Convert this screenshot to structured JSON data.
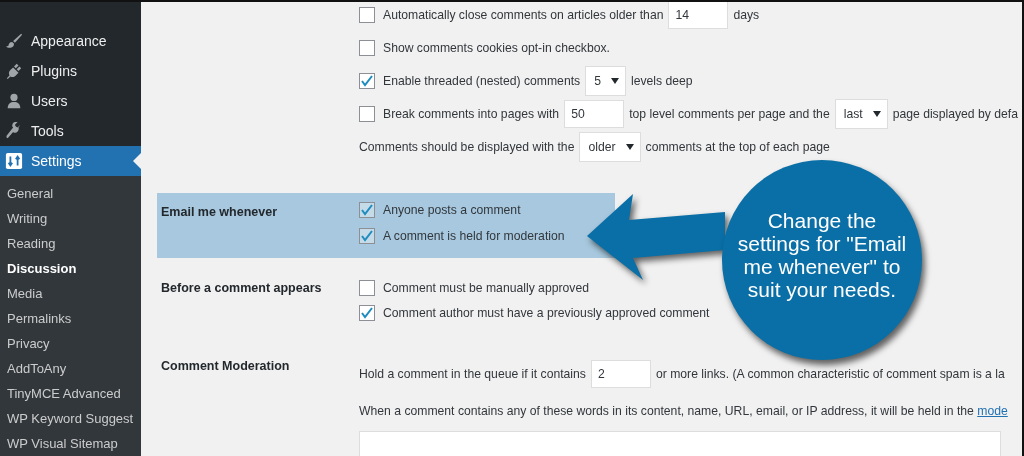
{
  "sidebar": {
    "menu": [
      {
        "label": "Appearance",
        "kind": "brush",
        "selected": false
      },
      {
        "label": "Plugins",
        "kind": "plug",
        "selected": false
      },
      {
        "label": "Users",
        "kind": "user",
        "selected": false
      },
      {
        "label": "Tools",
        "kind": "wrench",
        "selected": false
      },
      {
        "label": "Settings",
        "kind": "settings",
        "selected": true
      }
    ],
    "submenu": [
      {
        "label": "General",
        "selected": false
      },
      {
        "label": "Writing",
        "selected": false
      },
      {
        "label": "Reading",
        "selected": false
      },
      {
        "label": "Discussion",
        "selected": true
      },
      {
        "label": "Media",
        "selected": false
      },
      {
        "label": "Permalinks",
        "selected": false
      },
      {
        "label": "Privacy",
        "selected": false
      },
      {
        "label": "AddToAny",
        "selected": false
      },
      {
        "label": "TinyMCE Advanced",
        "selected": false
      },
      {
        "label": "WP Keyword Suggest",
        "selected": false
      },
      {
        "label": "WP Visual Sitemap",
        "selected": false
      }
    ]
  },
  "settings_rows": [
    {
      "lines": [
        {
          "kind": "checkbox",
          "checked": false,
          "segments": [
            {
              "kind": "text",
              "text": "Automatically close comments on articles older than"
            },
            {
              "kind": "input",
              "value": "14"
            },
            {
              "kind": "text",
              "text": "days"
            }
          ]
        },
        {
          "kind": "checkbox",
          "checked": false,
          "segments": [
            {
              "kind": "text",
              "text": "Show comments cookies opt-in checkbox."
            }
          ]
        },
        {
          "kind": "checkbox",
          "checked": true,
          "segments": [
            {
              "kind": "text",
              "text": "Enable threaded (nested) comments"
            },
            {
              "kind": "select",
              "value": "5"
            },
            {
              "kind": "text",
              "text": "levels deep"
            }
          ]
        },
        {
          "kind": "checkbox",
          "checked": false,
          "segments": [
            {
              "kind": "text",
              "text": "Break comments into pages with"
            },
            {
              "kind": "input",
              "value": "50"
            },
            {
              "kind": "text",
              "text": "top level comments per page and the"
            },
            {
              "kind": "select",
              "value": "last"
            },
            {
              "kind": "text",
              "text": "page displayed by defa"
            }
          ]
        },
        {
          "kind": "plain",
          "segments": [
            {
              "kind": "text",
              "text": "Comments should be displayed with the"
            },
            {
              "kind": "select",
              "value": "older"
            },
            {
              "kind": "text",
              "text": "comments at the top of each page"
            }
          ]
        }
      ]
    },
    {
      "label": "Email me whenever",
      "highlighted": true,
      "lines": [
        {
          "kind": "checkbox",
          "checked": true,
          "segments": [
            {
              "kind": "text",
              "text": "Anyone posts a comment"
            }
          ]
        },
        {
          "kind": "checkbox",
          "checked": true,
          "segments": [
            {
              "kind": "text",
              "text": "A comment is held for moderation"
            }
          ]
        }
      ]
    },
    {
      "label": "Before a comment appears",
      "lines": [
        {
          "kind": "checkbox",
          "checked": false,
          "segments": [
            {
              "kind": "text",
              "text": "Comment must be manually approved"
            }
          ]
        },
        {
          "kind": "checkbox",
          "checked": true,
          "segments": [
            {
              "kind": "text",
              "text": "Comment author must have a previously approved comment"
            }
          ]
        }
      ]
    },
    {
      "label": "Comment Moderation",
      "lines": [
        {
          "kind": "plain",
          "segments": [
            {
              "kind": "text",
              "text": "Hold a comment in the queue if it contains"
            },
            {
              "kind": "input",
              "value": "2"
            },
            {
              "kind": "text",
              "text": "or more links. (A common characteristic of comment spam is a la"
            }
          ]
        },
        {
          "kind": "plain",
          "segments": [
            {
              "kind": "text",
              "text": "When a comment contains any of these words in its content, name, URL, email, or IP address, it will be held in the"
            },
            {
              "kind": "link",
              "text": "mode"
            }
          ]
        },
        {
          "kind": "textarea"
        }
      ]
    }
  ],
  "callout": {
    "text": "Change the settings for \"Email me whenever\" to suit your needs."
  }
}
